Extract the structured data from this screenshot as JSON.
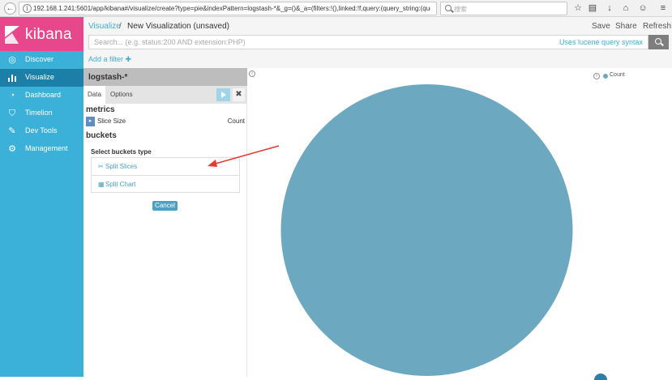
{
  "browser": {
    "url": "192.168.1.241:5601/app/kibana#/visualize/create?type=pie&indexPattern=logstash-*&_g=()&_a=(filters:!(),linked:!f,query:(query_string:(que",
    "search_placeholder": "搜索"
  },
  "app": {
    "logo_text": "kibana",
    "brand_color": "#e8488b",
    "sidebar_color": "#3bb0d8"
  },
  "sidebar": {
    "items": [
      {
        "label": "Discover",
        "icon": "compass-icon",
        "active": false
      },
      {
        "label": "Visualize",
        "icon": "bar-chart-icon",
        "active": true
      },
      {
        "label": "Dashboard",
        "icon": "dashboard-icon",
        "active": false
      },
      {
        "label": "Timelion",
        "icon": "shield-icon",
        "active": false
      },
      {
        "label": "Dev Tools",
        "icon": "wrench-icon",
        "active": false
      },
      {
        "label": "Management",
        "icon": "gear-icon",
        "active": false
      }
    ]
  },
  "header": {
    "breadcrumb_link": "Visualize",
    "breadcrumb_sep": "/",
    "breadcrumb_current": "New Visualization (unsaved)",
    "actions": [
      "Save",
      "Share",
      "Refresh"
    ]
  },
  "query": {
    "placeholder": "Search... (e.g. status:200 AND extension:PHP)",
    "lucene_link": "Uses lucene query syntax"
  },
  "filter": {
    "add_label": "Add a filter ✚"
  },
  "editor": {
    "index_pattern": "logstash-*",
    "tabs": [
      "Data",
      "Options"
    ],
    "metrics_heading": "metrics",
    "metric": {
      "label": "Slice Size",
      "value": "Count"
    },
    "buckets_heading": "buckets",
    "bucket_type_label": "Select buckets type",
    "bucket_options": [
      {
        "label": "Split Slices",
        "icon": "scissors-icon"
      },
      {
        "label": "Split Chart",
        "icon": "table-icon"
      }
    ],
    "cancel_label": "Cancel"
  },
  "chart_data": {
    "type": "pie",
    "categories": [
      "Count"
    ],
    "values": [
      1
    ],
    "colors": [
      "#6ca9c1"
    ],
    "legend": [
      "Count"
    ],
    "legend_position": "top-right"
  }
}
